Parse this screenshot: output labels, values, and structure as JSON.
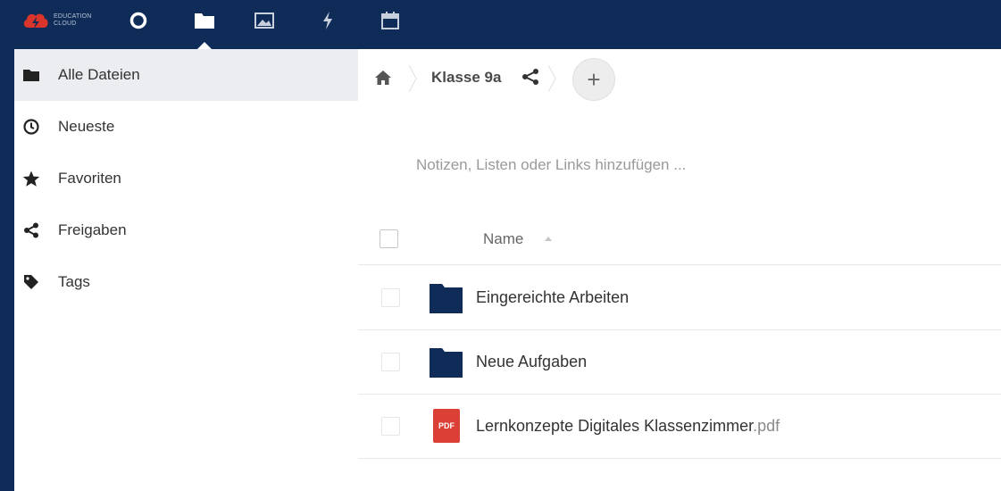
{
  "header": {
    "logo_text": [
      "EDUCATION",
      "CLOUD"
    ],
    "nav": [
      {
        "name": "dashboard",
        "icon": "circle-icon"
      },
      {
        "name": "files",
        "icon": "folder-icon",
        "active": true
      },
      {
        "name": "photos",
        "icon": "image-icon"
      },
      {
        "name": "activity",
        "icon": "lightning-icon"
      },
      {
        "name": "calendar",
        "icon": "calendar-icon"
      }
    ]
  },
  "sidebar": {
    "items": [
      {
        "label": "Alle Dateien",
        "icon": "folder-icon",
        "active": true
      },
      {
        "label": "Neueste",
        "icon": "clock-icon"
      },
      {
        "label": "Favoriten",
        "icon": "star-icon"
      },
      {
        "label": "Freigaben",
        "icon": "share-icon"
      },
      {
        "label": "Tags",
        "icon": "tag-icon"
      }
    ]
  },
  "breadcrumb": {
    "current": "Klasse 9a",
    "add_label": "+"
  },
  "notes_placeholder": "Notizen, Listen oder Links hinzufügen ...",
  "table": {
    "name_header": "Name",
    "files": [
      {
        "name": "Eingereichte Arbeiten",
        "ext": "",
        "type": "folder"
      },
      {
        "name": "Neue Aufgaben",
        "ext": "",
        "type": "folder"
      },
      {
        "name": "Lernkonzepte Digitales Klassenzimmer",
        "ext": ".pdf",
        "type": "pdf",
        "badge": "PDF"
      }
    ]
  },
  "colors": {
    "header_bg": "#0e2c57",
    "folder": "#0e2c57",
    "pdf": "#dc3f36",
    "active_bg": "#ebedf0"
  }
}
